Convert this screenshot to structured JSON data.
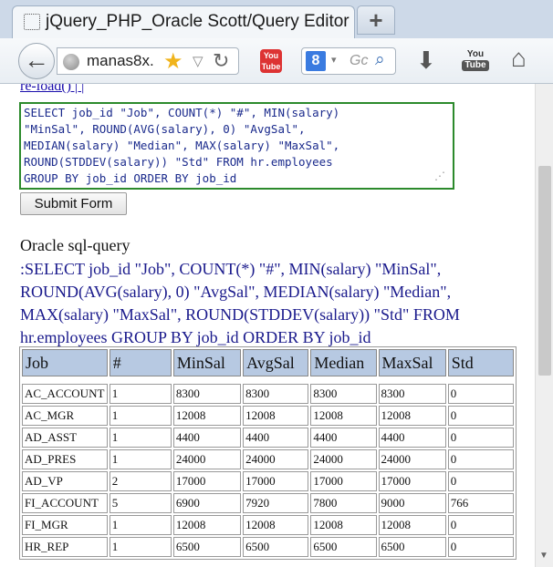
{
  "browser": {
    "tab_title": "jQuery_PHP_Oracle Scott/Query Editor",
    "new_tab_label": "+",
    "url_text": "manas8x.",
    "search_placeholder": "Gc",
    "search_engine_letter": "8",
    "addon_label": "You Tube",
    "youtube_top": "You",
    "youtube_bottom": "Tube",
    "icons": [
      "back-arrow-icon",
      "globe-icon",
      "star-icon",
      "dropdown-icon",
      "reload-icon",
      "addon-icon",
      "google-icon",
      "search-icon",
      "download-icon",
      "youtube-icon",
      "home-icon"
    ]
  },
  "page": {
    "reload_link": "re-load() | |",
    "textarea_value": "SELECT job_id \"Job\", COUNT(*) \"#\", MIN(salary)\n\"MinSal\", ROUND(AVG(salary), 0) \"AvgSal\",\nMEDIAN(salary) \"Median\", MAX(salary) \"MaxSal\",\nROUND(STDDEV(salary)) \"Std\" FROM hr.employees\nGROUP BY job_id ORDER BY job_id",
    "submit_label": "Submit Form",
    "heading": "Oracle sql-query",
    "query_echo": ":SELECT job_id \"Job\", COUNT(*) \"#\", MIN(salary) \"MinSal\", ROUND(AVG(salary), 0) \"AvgSal\", MEDIAN(salary) \"Median\", MAX(salary) \"MaxSal\", ROUND(STDDEV(salary)) \"Std\" FROM hr.employees GROUP BY job_id ORDER BY job_id"
  },
  "table": {
    "header_color": "#b7c9e2",
    "columns": [
      "Job",
      "#",
      "MinSal",
      "AvgSal",
      "Median",
      "MaxSal",
      "Std"
    ],
    "rows": [
      [
        "AC_ACCOUNT",
        "1",
        "8300",
        "8300",
        "8300",
        "8300",
        "0"
      ],
      [
        "AC_MGR",
        "1",
        "12008",
        "12008",
        "12008",
        "12008",
        "0"
      ],
      [
        "AD_ASST",
        "1",
        "4400",
        "4400",
        "4400",
        "4400",
        "0"
      ],
      [
        "AD_PRES",
        "1",
        "24000",
        "24000",
        "24000",
        "24000",
        "0"
      ],
      [
        "AD_VP",
        "2",
        "17000",
        "17000",
        "17000",
        "17000",
        "0"
      ],
      [
        "FI_ACCOUNT",
        "5",
        "6900",
        "7920",
        "7800",
        "9000",
        "766"
      ],
      [
        "FI_MGR",
        "1",
        "12008",
        "12008",
        "12008",
        "12008",
        "0"
      ],
      [
        "HR_REP",
        "1",
        "6500",
        "6500",
        "6500",
        "6500",
        "0"
      ]
    ]
  }
}
